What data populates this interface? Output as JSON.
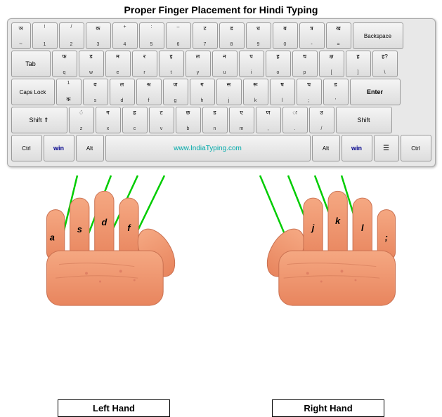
{
  "title": "Proper Finger Placement for Hindi Typing",
  "left_hand_label": "Left Hand",
  "right_hand_label": "Right Hand",
  "website": "www.IndiaTyping.com",
  "finger_labels": {
    "left": [
      "a",
      "s",
      "d",
      "f"
    ],
    "right": [
      "j",
      "k",
      "l",
      ";"
    ]
  }
}
